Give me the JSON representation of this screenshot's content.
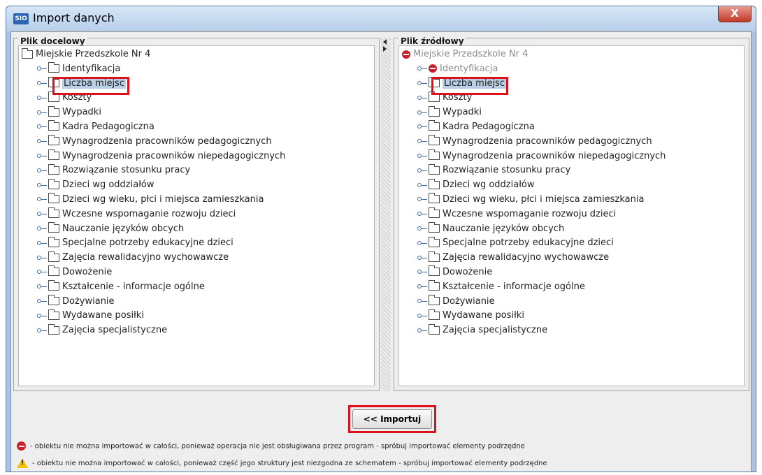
{
  "window": {
    "app_icon": "SIO",
    "title": "Import danych",
    "close_glyph": "X"
  },
  "left_panel": {
    "title": "Plik docelowy",
    "root": "Miejskie Przedszkole Nr 4",
    "items": [
      {
        "label": "Identyfikacja"
      },
      {
        "label": "Liczba miejsc"
      },
      {
        "label": "Koszty"
      },
      {
        "label": "Wypadki"
      },
      {
        "label": "Kadra Pedagogiczna"
      },
      {
        "label": "Wynagrodzenia pracowników pedagogicznych"
      },
      {
        "label": "Wynagrodzenia pracowników niepedagogicznych"
      },
      {
        "label": "Rozwiązanie stosunku pracy"
      },
      {
        "label": "Dzieci wg oddziałów"
      },
      {
        "label": "Dzieci wg wieku, płci i miejsca zamieszkania"
      },
      {
        "label": "Wczesne wspomaganie rozwoju dzieci"
      },
      {
        "label": "Nauczanie języków obcych"
      },
      {
        "label": "Specjalne potrzeby edukacyjne dzieci"
      },
      {
        "label": "Zajęcia rewalidacyjno wychowawcze"
      },
      {
        "label": "Dowożenie"
      },
      {
        "label": "Kształcenie - informacje ogólne"
      },
      {
        "label": "Dożywianie"
      },
      {
        "label": "Wydawane posiłki"
      },
      {
        "label": "Zajęcia specjalistyczne"
      }
    ]
  },
  "right_panel": {
    "title": "Plik źródłowy",
    "root": "Miejskie Przedszkole Nr 4",
    "items": [
      {
        "label": "Identyfikacja"
      },
      {
        "label": "Liczba miejsc"
      },
      {
        "label": "Koszty"
      },
      {
        "label": "Wypadki"
      },
      {
        "label": "Kadra Pedagogiczna"
      },
      {
        "label": "Wynagrodzenia pracowników pedagogicznych"
      },
      {
        "label": "Wynagrodzenia pracowników niepedagogicznych"
      },
      {
        "label": "Rozwiązanie stosunku pracy"
      },
      {
        "label": "Dzieci wg oddziałów"
      },
      {
        "label": "Dzieci wg wieku, płci i miejsca zamieszkania"
      },
      {
        "label": "Wczesne wspomaganie rozwoju dzieci"
      },
      {
        "label": "Nauczanie języków obcych"
      },
      {
        "label": "Specjalne potrzeby edukacyjne dzieci"
      },
      {
        "label": "Zajęcia rewalidacyjno wychowawcze"
      },
      {
        "label": "Dowożenie"
      },
      {
        "label": "Kształcenie - informacje ogólne"
      },
      {
        "label": "Dożywianie"
      },
      {
        "label": "Wydawane posiłki"
      },
      {
        "label": "Zajęcia specjalistyczne"
      }
    ]
  },
  "import_button": {
    "label": "<< Importuj"
  },
  "legend": {
    "no_entry": "- obiektu nie można importować w całości, ponieważ operacja nie jest obsługiwana przez program - spróbuj importować elementy podrzędne",
    "warning": "- obiektu nie można importować w całości, ponieważ część jego struktury jest niezgodna ze schematem - spróbuj importować elementy podrzędne"
  },
  "colors": {
    "highlight": "#e0101a",
    "selection": "#b8cfe5",
    "disabled_text": "#8c8c8c"
  }
}
